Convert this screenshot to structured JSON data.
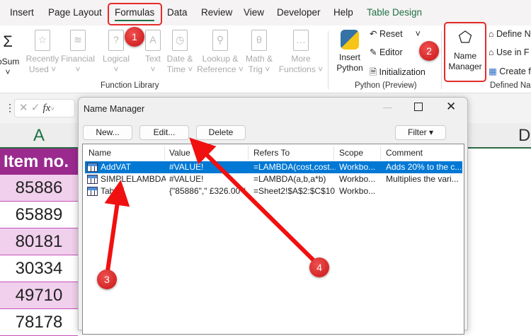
{
  "tabs": [
    {
      "label": "Insert"
    },
    {
      "label": "Page Layout"
    },
    {
      "label": "Formulas"
    },
    {
      "label": "Data"
    },
    {
      "label": "Review"
    },
    {
      "label": "View"
    },
    {
      "label": "Developer"
    },
    {
      "label": "Help"
    },
    {
      "label": "Table Design"
    }
  ],
  "ribbon": {
    "autosum": "oSum",
    "function_library": [
      {
        "l1": "Recently",
        "l2": "Used ˅",
        "icon": "star-icon",
        "glyph": "☆"
      },
      {
        "l1": "Financial",
        "l2": "˅",
        "icon": "database-icon",
        "glyph": "≋"
      },
      {
        "l1": "Logical",
        "l2": "˅",
        "icon": "question-icon",
        "glyph": "?"
      },
      {
        "l1": "Text",
        "l2": "˅",
        "icon": "text-icon",
        "glyph": "A"
      },
      {
        "l1": "Date &",
        "l2": "Time ˅",
        "icon": "clock-icon",
        "glyph": "◷"
      },
      {
        "l1": "Lookup &",
        "l2": "Reference ˅",
        "icon": "magnifier-icon",
        "glyph": "⚲"
      },
      {
        "l1": "Math &",
        "l2": "Trig ˅",
        "icon": "theta-icon",
        "glyph": "θ"
      },
      {
        "l1": "More",
        "l2": "Functions ˅",
        "icon": "more-icon",
        "glyph": "…"
      }
    ],
    "function_library_label": "Function Library",
    "insert_python": [
      "Insert",
      "Python"
    ],
    "python_items": [
      "Reset",
      "Editor",
      "Initialization"
    ],
    "python_label": "Python (Preview)",
    "name_manager": [
      "Name",
      "Manager"
    ],
    "defined_items": [
      "Define N",
      "Use in F",
      "Create f"
    ],
    "defined_label": "Defined Na"
  },
  "formula_bar": {
    "fx": "fx"
  },
  "sheet": {
    "col_a": "A",
    "col_d": "D",
    "header": "Item no.",
    "items": [
      "85886",
      "65889",
      "80181",
      "30334",
      "49710",
      "78178"
    ],
    "header_color": "#9b2a8f",
    "alt_color": "#f0d0ec"
  },
  "dialog": {
    "title": "Name Manager",
    "buttons": {
      "new": "New...",
      "edit": "Edit...",
      "delete": "Delete",
      "filter": "Filter ▾"
    },
    "columns": [
      "Name",
      "Value",
      "Refers To",
      "Scope",
      "Comment"
    ],
    "rows": [
      {
        "name": "AddVAT",
        "value": "#VALUE!",
        "refers": "=LAMBDA(cost,cost...",
        "scope": "Workbo...",
        "comment": "Adds 20% to the c..."
      },
      {
        "name": "SIMPLELAMBDA",
        "value": "#VALUE!",
        "refers": "=LAMBDA(a,b,a*b)",
        "scope": "Workbo...",
        "comment": "Multiplies the vari..."
      },
      {
        "name": "Table1",
        "value": "{\"85886\",\" £326.00 \"...",
        "refers": "=Sheet2!$A$2:$C$10",
        "scope": "Workbo...",
        "comment": ""
      }
    ],
    "selection_color": "#0078d4"
  },
  "annotations": [
    "1",
    "2",
    "3",
    "4"
  ],
  "annotation_color": "#e52b2b"
}
